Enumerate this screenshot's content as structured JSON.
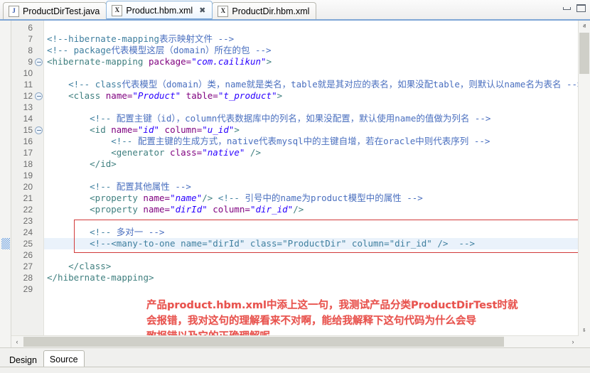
{
  "window": {
    "minimize_label": "minimize-window",
    "maximize_label": "maximize-window"
  },
  "tabs": [
    {
      "icon": "J",
      "icon_name": "java-file-icon",
      "label": "ProductDirTest.java",
      "active": false,
      "closable": false
    },
    {
      "icon": "X",
      "icon_name": "xml-file-icon",
      "label": "Product.hbm.xml",
      "active": true,
      "closable": true,
      "close_glyph": "✖"
    },
    {
      "icon": "X",
      "icon_name": "xml-file-icon",
      "label": "ProductDir.hbm.xml",
      "active": false,
      "closable": false
    }
  ],
  "editor": {
    "current_line": 25,
    "first_visible_line": 6,
    "fold_lines": [
      9,
      12,
      15
    ],
    "lines": [
      {
        "n": 6,
        "segments": []
      },
      {
        "n": 7,
        "segments": [
          {
            "t": "<!--hibernate-mapping",
            "c": "cm"
          },
          {
            "t": "表示映射文件 -->",
            "c": "cmz"
          }
        ]
      },
      {
        "n": 8,
        "segments": [
          {
            "t": "<!-- package",
            "c": "cm"
          },
          {
            "t": "代表模型这层（domain）所在的包 -->",
            "c": "cmz"
          }
        ]
      },
      {
        "n": 9,
        "segments": [
          {
            "t": "<hibernate-mapping ",
            "c": "tg"
          },
          {
            "t": "package=",
            "c": "at"
          },
          {
            "t": "\"com.cailikun\"",
            "c": "vl"
          },
          {
            "t": ">",
            "c": "tg"
          }
        ]
      },
      {
        "n": 10,
        "segments": []
      },
      {
        "n": 11,
        "indent": 4,
        "segments": [
          {
            "t": "<!-- class",
            "c": "cm"
          },
          {
            "t": "代表模型（domain）类，name就是类名，table就是其对应的表名，如果没配table，则默认以name名为表名 -->",
            "c": "cmz"
          }
        ]
      },
      {
        "n": 12,
        "indent": 4,
        "segments": [
          {
            "t": "<class ",
            "c": "tg"
          },
          {
            "t": "name=",
            "c": "at"
          },
          {
            "t": "\"Product\"",
            "c": "vl"
          },
          {
            "t": " table=",
            "c": "at"
          },
          {
            "t": "\"t_product\"",
            "c": "vl"
          },
          {
            "t": ">",
            "c": "tg"
          }
        ]
      },
      {
        "n": 13,
        "segments": []
      },
      {
        "n": 14,
        "indent": 8,
        "segments": [
          {
            "t": "<!-- ",
            "c": "cm"
          },
          {
            "t": "配置主键（id），column代表数据库中的列名，如果没配置，默认使用name的值做为列名 -->",
            "c": "cmz"
          }
        ]
      },
      {
        "n": 15,
        "indent": 8,
        "segments": [
          {
            "t": "<id ",
            "c": "tg"
          },
          {
            "t": "name=",
            "c": "at"
          },
          {
            "t": "\"id\"",
            "c": "vl"
          },
          {
            "t": " column=",
            "c": "at"
          },
          {
            "t": "\"u_id\"",
            "c": "vl"
          },
          {
            "t": ">",
            "c": "tg"
          }
        ]
      },
      {
        "n": 16,
        "indent": 12,
        "segments": [
          {
            "t": "<!-- ",
            "c": "cm"
          },
          {
            "t": "配置主键的生成方式，native代表mysql中的主键自增，若在oracle中则代表序列 -->",
            "c": "cmz"
          }
        ]
      },
      {
        "n": 17,
        "indent": 12,
        "segments": [
          {
            "t": "<generator ",
            "c": "tg"
          },
          {
            "t": "class=",
            "c": "at"
          },
          {
            "t": "\"native\"",
            "c": "vl"
          },
          {
            "t": " />",
            "c": "tg"
          }
        ]
      },
      {
        "n": 18,
        "indent": 8,
        "segments": [
          {
            "t": "</id>",
            "c": "tg"
          }
        ]
      },
      {
        "n": 19,
        "segments": []
      },
      {
        "n": 20,
        "indent": 8,
        "segments": [
          {
            "t": "<!-- ",
            "c": "cm"
          },
          {
            "t": "配置其他属性 -->",
            "c": "cmz"
          }
        ]
      },
      {
        "n": 21,
        "indent": 8,
        "segments": [
          {
            "t": "<property ",
            "c": "tg"
          },
          {
            "t": "name=",
            "c": "at"
          },
          {
            "t": "\"name\"",
            "c": "vl"
          },
          {
            "t": "/> ",
            "c": "tg"
          },
          {
            "t": "<!-- ",
            "c": "cm"
          },
          {
            "t": "引号中的name为product模型中的属性 -->",
            "c": "cmz"
          }
        ]
      },
      {
        "n": 22,
        "indent": 8,
        "segments": [
          {
            "t": "<property ",
            "c": "tg"
          },
          {
            "t": "name=",
            "c": "at"
          },
          {
            "t": "\"dirId\"",
            "c": "vl"
          },
          {
            "t": " column=",
            "c": "at"
          },
          {
            "t": "\"dir_id\"",
            "c": "vl"
          },
          {
            "t": "/>",
            "c": "tg"
          }
        ]
      },
      {
        "n": 23,
        "segments": []
      },
      {
        "n": 24,
        "indent": 8,
        "segments": [
          {
            "t": "<!-- ",
            "c": "cm"
          },
          {
            "t": "多对一 -->",
            "c": "cmz"
          }
        ]
      },
      {
        "n": 25,
        "indent": 8,
        "segments": [
          {
            "t": "<!--<many-to-one name=\"dirId\" class=\"ProductDir\" column=\"dir_id\" />  -->",
            "c": "cm"
          }
        ]
      },
      {
        "n": 26,
        "segments": []
      },
      {
        "n": 27,
        "indent": 4,
        "segments": [
          {
            "t": "</class>",
            "c": "tg"
          }
        ]
      },
      {
        "n": 28,
        "segments": [
          {
            "t": "</hibernate-mapping>",
            "c": "tg"
          }
        ]
      },
      {
        "n": 29,
        "segments": []
      }
    ]
  },
  "annotation": {
    "box_label": "highlight-box-many-to-one",
    "color": "#e8534e",
    "text_lines": [
      "产品product.hbm.xml中添上这一句，我测试产品分类ProductDirTest时就",
      "会报错，我对这句的理解看来不对啊，能给我解释下这句代码为什么会导",
      "致报错以及它的正确理解呢"
    ]
  },
  "scrollbars": {
    "vertical_up": "ⱏ",
    "vertical_down": "ⱛ",
    "horizontal_left": "‹",
    "horizontal_right": "›"
  },
  "bottom_tabs": [
    {
      "label": "Design",
      "selected": false
    },
    {
      "label": "Source",
      "selected": true
    }
  ]
}
